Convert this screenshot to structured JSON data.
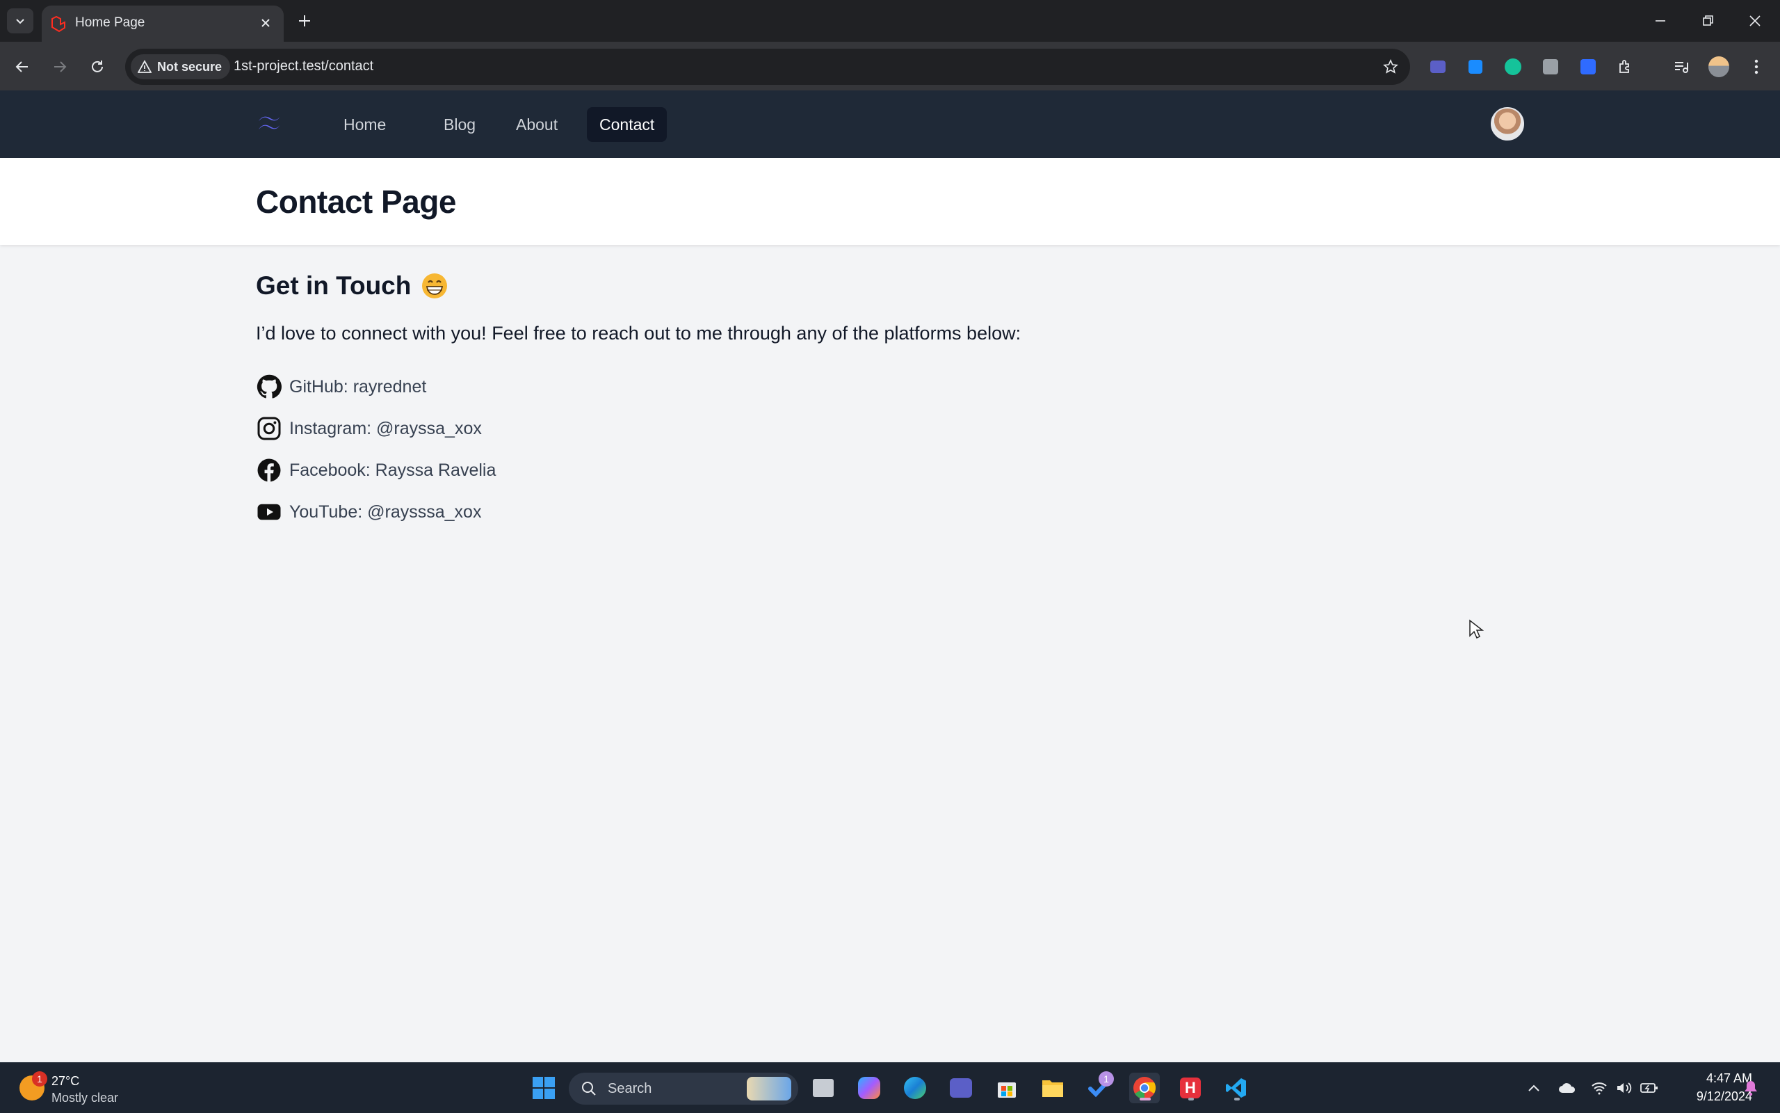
{
  "browser": {
    "tab_title": "Home Page",
    "security_label": "Not secure",
    "url": "1st-project.test/contact"
  },
  "site": {
    "nav": [
      {
        "label": "Home",
        "active": false
      },
      {
        "label": "Blog",
        "active": false
      },
      {
        "label": "About",
        "active": false
      },
      {
        "label": "Contact",
        "active": true
      }
    ]
  },
  "page": {
    "title": "Contact Page",
    "heading": "Get in Touch",
    "intro": "I’d love to connect with you! Feel free to reach out to me through any of the platforms below:",
    "contacts": [
      {
        "icon": "github-icon",
        "label": "GitHub: rayrednet"
      },
      {
        "icon": "instagram-icon",
        "label": "Instagram: @rayssa_xox"
      },
      {
        "icon": "facebook-icon",
        "label": "Facebook: Rayssa Ravelia"
      },
      {
        "icon": "youtube-icon",
        "label": "YouTube: @raysssa_xox"
      }
    ]
  },
  "taskbar": {
    "weather_temp": "27°C",
    "weather_condition": "Mostly clear",
    "weather_badge": "1",
    "search_label": "Search",
    "todo_badge": "1",
    "time": "4:47 AM",
    "date": "9/12/2024"
  },
  "colors": {
    "nav_bg": "#1f2937",
    "nav_active_bg": "#111827",
    "page_bg": "#f3f4f6",
    "brand_logo": "#6366f1"
  }
}
